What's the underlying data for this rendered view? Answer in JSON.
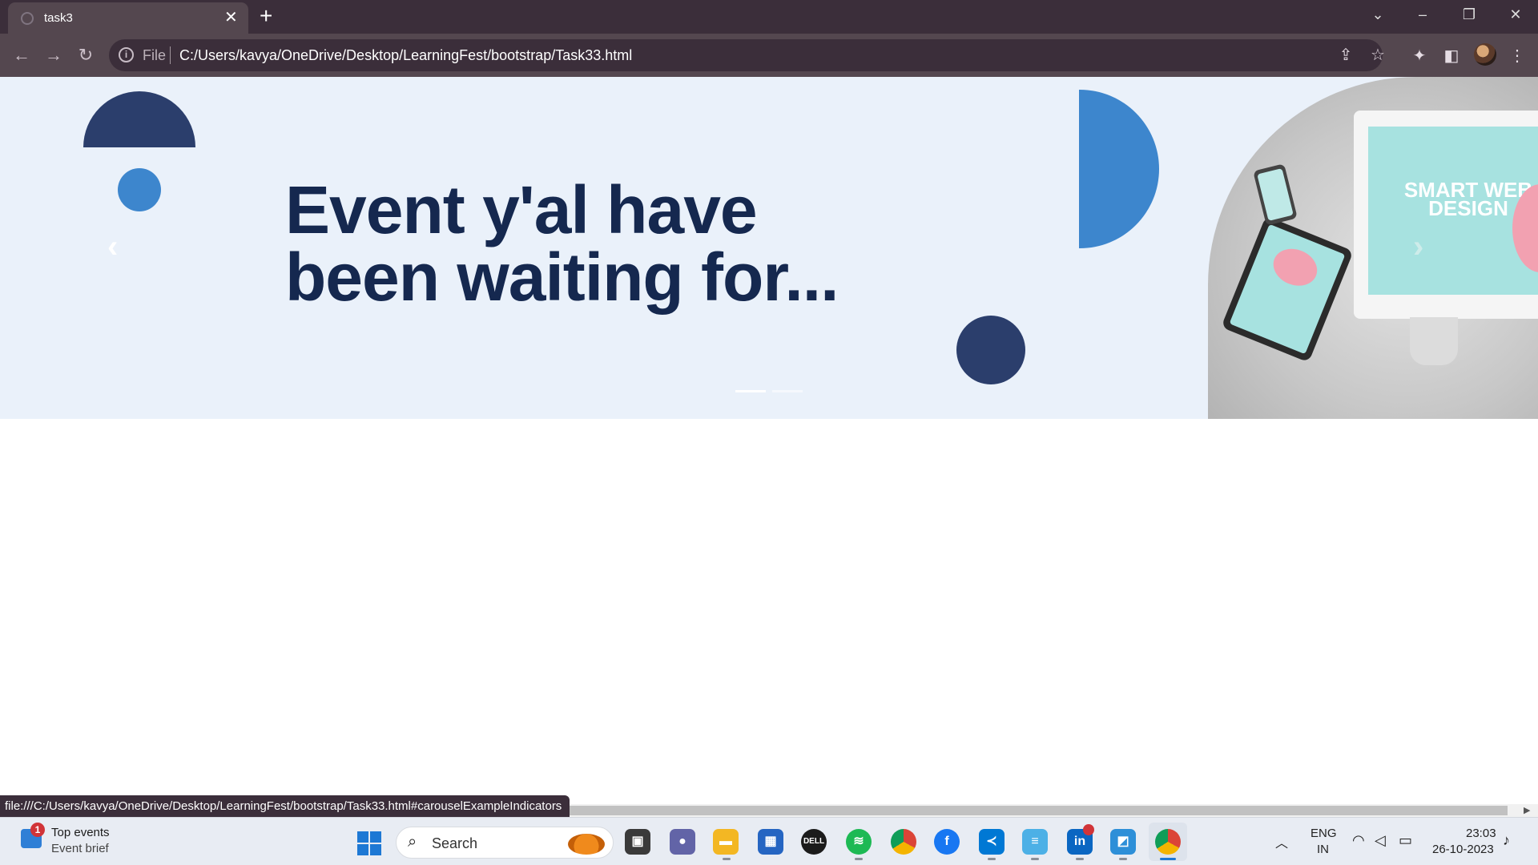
{
  "browser": {
    "tab_title": "task3",
    "tab_close": "✕",
    "new_tab": "+",
    "scheme": "File",
    "url": "C:/Users/kavya/OneDrive/Desktop/LearningFest/bootstrap/Task33.html",
    "status_url": "file:///C:/Users/kavya/OneDrive/Desktop/LearningFest/bootstrap/Task33.html#carouselExampleIndicators"
  },
  "hero": {
    "headline_line1": "Event y'al have",
    "headline_line2": "been waiting for...",
    "prev_glyph": "‹",
    "next_glyph": "›",
    "active_slide": 1,
    "slide_count": 2,
    "colors": {
      "navy": "#2b3e6c",
      "blue": "#3d86cd",
      "bg": "#eaf1fa",
      "text": "#15284f"
    },
    "photo_brand": "SMART WEB DESIGN"
  },
  "taskbar": {
    "widget_title": "Top events",
    "widget_subtitle": "Event brief",
    "widget_badge": "1",
    "search_label": "Search",
    "lang_line1": "ENG",
    "lang_line2": "IN",
    "time": "23:03",
    "date": "26-10-2023",
    "apps": [
      "file-explorer-icon",
      "teams-icon",
      "folder-icon",
      "store-icon",
      "dell-icon",
      "spotify-icon",
      "chrome-icon",
      "facebook-icon",
      "vscode-icon",
      "notepad-icon",
      "linkedin-icon",
      "photos-icon",
      "chrome-profile-icon"
    ]
  }
}
